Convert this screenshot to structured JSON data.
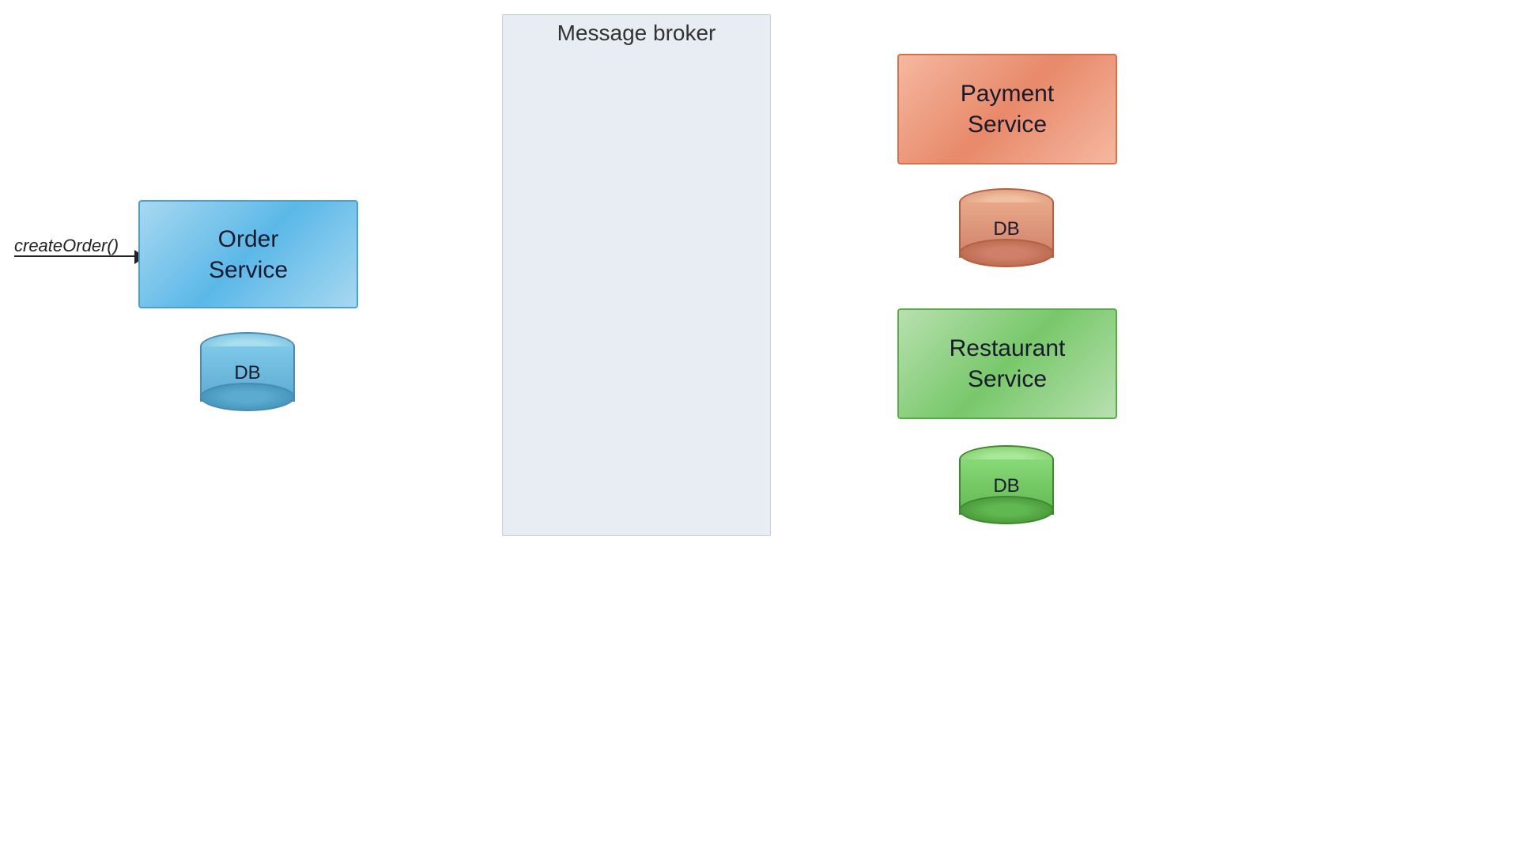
{
  "diagram": {
    "background": "#ffffff",
    "createOrder": {
      "label": "createOrder()"
    },
    "orderService": {
      "label": "Order\nService",
      "line1": "Order",
      "line2": "Service"
    },
    "orderDb": {
      "label": "DB"
    },
    "messageBroker": {
      "label": "Message broker"
    },
    "paymentService": {
      "label": "Payment\nService",
      "line1": "Payment",
      "line2": "Service"
    },
    "paymentDb": {
      "label": "DB"
    },
    "restaurantService": {
      "label": "Restaurant\nService",
      "line1": "Restaurant",
      "line2": "Service"
    },
    "restaurantDb": {
      "label": "DB"
    }
  }
}
